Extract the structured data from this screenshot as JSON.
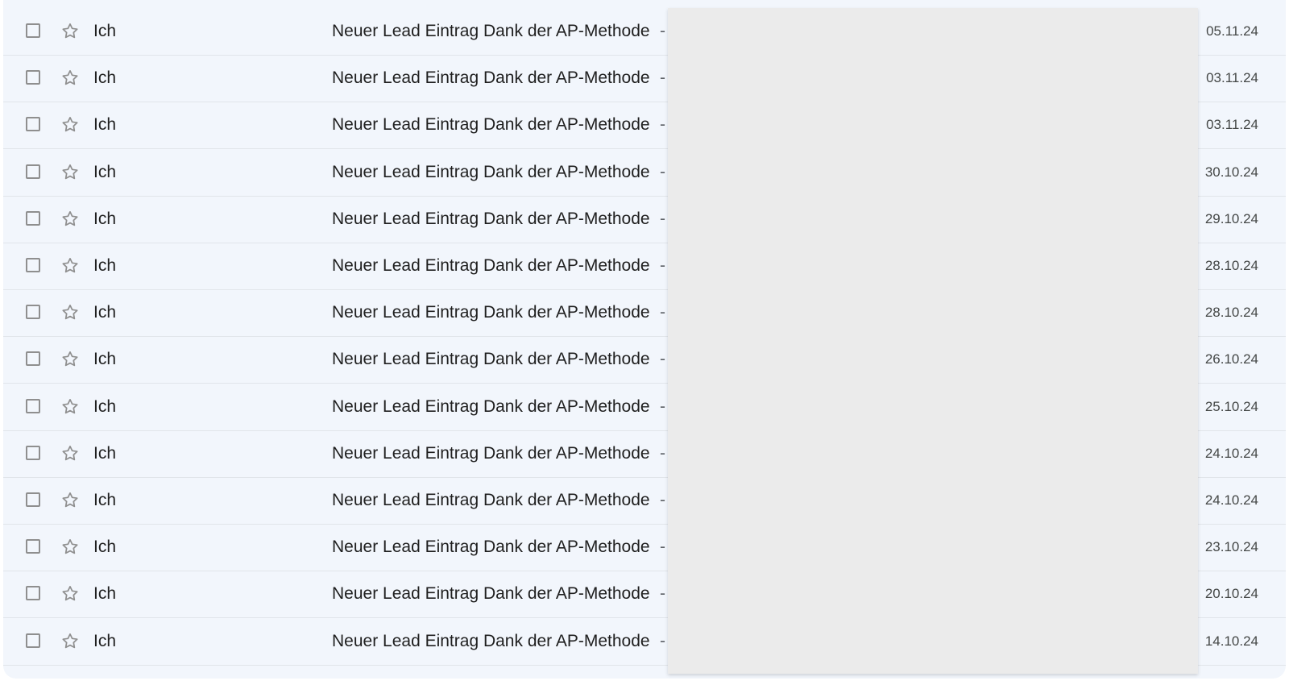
{
  "rows": [
    {
      "sender": "Ich",
      "subject": "Neuer Lead Eintrag Dank der AP-Methode",
      "separator": "-",
      "date": "05.11.24"
    },
    {
      "sender": "Ich",
      "subject": "Neuer Lead Eintrag Dank der AP-Methode",
      "separator": "-",
      "date": "03.11.24"
    },
    {
      "sender": "Ich",
      "subject": "Neuer Lead Eintrag Dank der AP-Methode",
      "separator": "-",
      "date": "03.11.24"
    },
    {
      "sender": "Ich",
      "subject": "Neuer Lead Eintrag Dank der AP-Methode",
      "separator": "-",
      "date": "30.10.24"
    },
    {
      "sender": "Ich",
      "subject": "Neuer Lead Eintrag Dank der AP-Methode",
      "separator": "-",
      "date": "29.10.24"
    },
    {
      "sender": "Ich",
      "subject": "Neuer Lead Eintrag Dank der AP-Methode",
      "separator": "-",
      "date": "28.10.24"
    },
    {
      "sender": "Ich",
      "subject": "Neuer Lead Eintrag Dank der AP-Methode",
      "separator": "-",
      "date": "28.10.24"
    },
    {
      "sender": "Ich",
      "subject": "Neuer Lead Eintrag Dank der AP-Methode",
      "separator": "-",
      "date": "26.10.24"
    },
    {
      "sender": "Ich",
      "subject": "Neuer Lead Eintrag Dank der AP-Methode",
      "separator": "-",
      "date": "25.10.24"
    },
    {
      "sender": "Ich",
      "subject": "Neuer Lead Eintrag Dank der AP-Methode",
      "separator": "-",
      "date": "24.10.24"
    },
    {
      "sender": "Ich",
      "subject": "Neuer Lead Eintrag Dank der AP-Methode",
      "separator": "-",
      "date": "24.10.24"
    },
    {
      "sender": "Ich",
      "subject": "Neuer Lead Eintrag Dank der AP-Methode",
      "separator": "-",
      "date": "23.10.24"
    },
    {
      "sender": "Ich",
      "subject": "Neuer Lead Eintrag Dank der AP-Methode",
      "separator": "-",
      "date": "20.10.24"
    },
    {
      "sender": "Ich",
      "subject": "Neuer Lead Eintrag Dank der AP-Methode",
      "separator": "-",
      "date": "14.10.24"
    }
  ],
  "icons": {
    "checkbox": "checkbox-icon",
    "star": "star-outline-icon"
  },
  "colors": {
    "row_background": "#f2f6fc",
    "redaction": "#ebebeb"
  }
}
